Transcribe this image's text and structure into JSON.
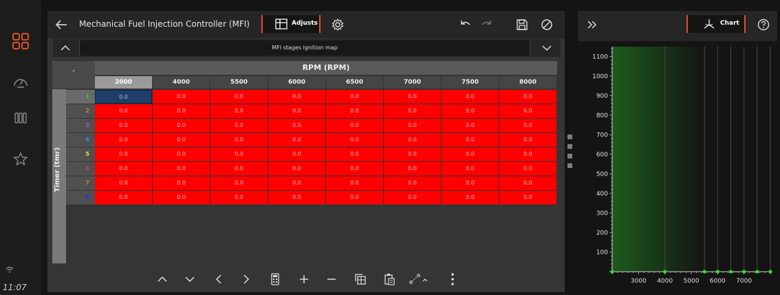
{
  "status": {
    "time": "11:07"
  },
  "header": {
    "title": "Mechanical Fuel Injection Controller (MFI)",
    "tab_label": "Adjusts",
    "chart_label": "Chart"
  },
  "map": {
    "subtitle": "MFI stages ignition map",
    "corner_symbol": "°",
    "column_axis_label": "RPM (RPM)",
    "row_axis_label": "Timer (tmr)",
    "columns": [
      "2000",
      "4000",
      "5500",
      "6000",
      "6500",
      "7000",
      "7500",
      "8000"
    ],
    "rows": [
      {
        "label": "1",
        "color": "#2fd12f"
      },
      {
        "label": "2",
        "color": "#e07a26"
      },
      {
        "label": "3",
        "color": "#b04fd6"
      },
      {
        "label": "4",
        "color": "#3a8fe0"
      },
      {
        "label": "5",
        "color": "#e8e040"
      },
      {
        "label": "6",
        "color": "#e03a3a"
      },
      {
        "label": "7",
        "color": "#e07a26"
      },
      {
        "label": "8",
        "color": "#2030e8"
      }
    ],
    "cell_value": "0.0"
  },
  "chart_data": {
    "type": "scatter",
    "title": "",
    "xlabel": "",
    "ylabel": "",
    "x_ticks": [
      "3000",
      "4000",
      "5000",
      "6000",
      "7000"
    ],
    "y_ticks": [
      "100",
      "200",
      "300",
      "400",
      "500",
      "600",
      "700",
      "800",
      "900",
      "1000",
      "1100"
    ],
    "xlim": [
      2000,
      8000
    ],
    "ylim": [
      0,
      1150
    ],
    "x": [
      2000,
      4000,
      5500,
      6000,
      6500,
      7000,
      7500,
      8000
    ],
    "y": [
      0,
      0,
      0,
      0,
      0,
      0,
      0,
      0
    ],
    "point_color": "#2fe02f",
    "highlight_color": "#1d5a1d"
  }
}
